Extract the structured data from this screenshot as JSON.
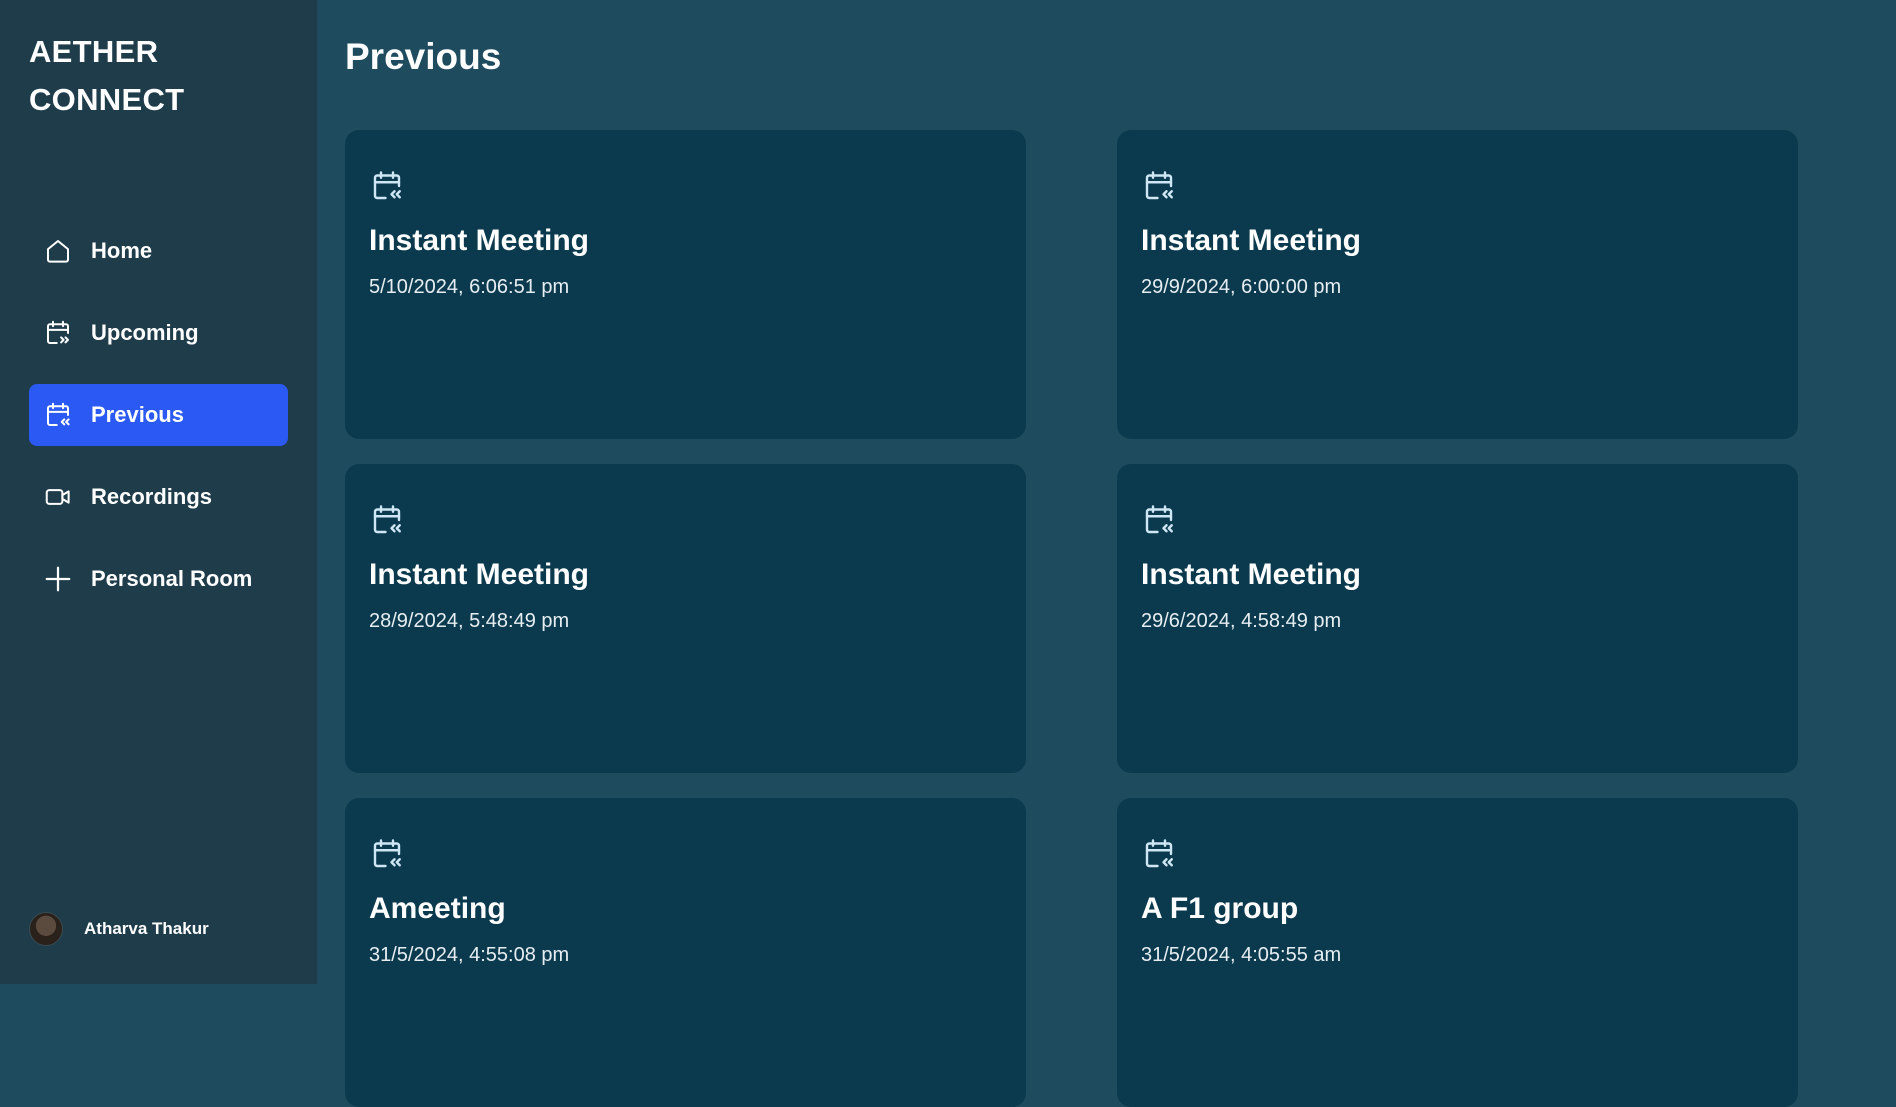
{
  "brand": {
    "line1": "AETHER",
    "line2": "CONNECT"
  },
  "sidebar": {
    "items": [
      {
        "label": "Home",
        "icon": "home-icon",
        "active": false
      },
      {
        "label": "Upcoming",
        "icon": "calendar-forward-icon",
        "active": false
      },
      {
        "label": "Previous",
        "icon": "calendar-back-icon",
        "active": true
      },
      {
        "label": "Recordings",
        "icon": "video-camera-icon",
        "active": false
      },
      {
        "label": "Personal Room",
        "icon": "plus-icon",
        "active": false
      }
    ],
    "user": {
      "name": "Atharva Thakur"
    }
  },
  "main": {
    "title": "Previous",
    "meetings": [
      {
        "title": "Instant Meeting",
        "date": "5/10/2024, 6:06:51 pm"
      },
      {
        "title": "Instant Meeting",
        "date": "29/9/2024, 6:00:00 pm"
      },
      {
        "title": "Instant Meeting",
        "date": "28/9/2024, 5:48:49 pm"
      },
      {
        "title": "Instant Meeting",
        "date": "29/6/2024, 4:58:49 pm"
      },
      {
        "title": "Ameeting",
        "date": "31/5/2024, 4:55:08 pm"
      },
      {
        "title": "A F1 group",
        "date": "31/5/2024, 4:05:55 am"
      }
    ]
  },
  "colors": {
    "sidebar_bg": "#1f3c4b",
    "main_bg": "#1f4b5e",
    "card_bg": "#0b3a4e",
    "active": "#2b59f3"
  }
}
